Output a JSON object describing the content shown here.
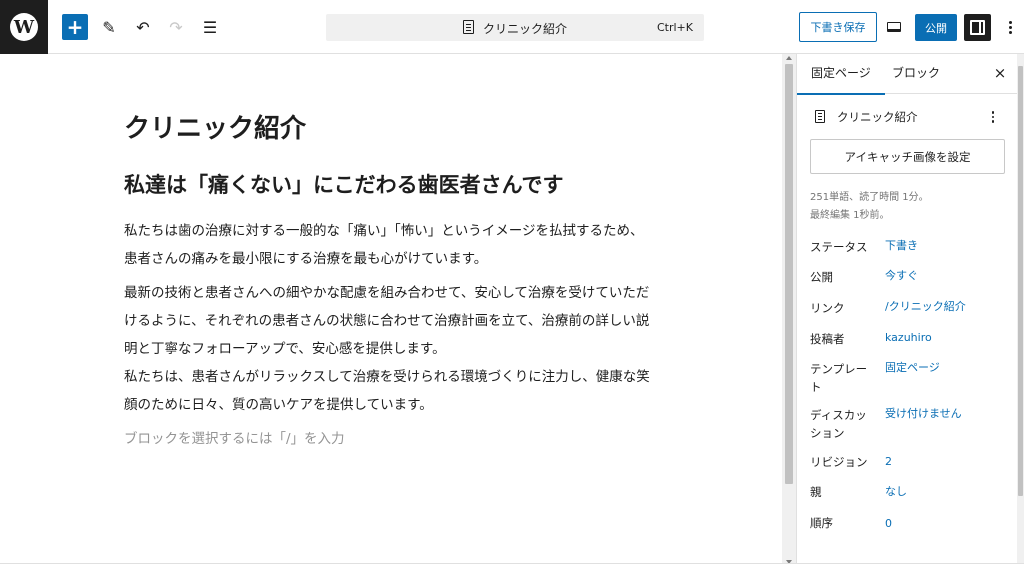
{
  "toolbar": {
    "logo_letter": "W",
    "add_symbol": "+",
    "tools_glyph": "✎",
    "undo_glyph": "↶",
    "redo_glyph": "↷",
    "list_glyph": "☰",
    "doc_title": "クリニック紹介",
    "shortcut": "Ctrl+K",
    "save_draft_label": "下書き保存",
    "publish_label": "公開"
  },
  "post": {
    "title": "クリニック紹介",
    "heading": "私達は「痛くない」にこだわる歯医者さんです",
    "paragraphs": [
      "私たちは歯の治療に対する一般的な「痛い」「怖い」というイメージを払拭するため、患者さんの痛みを最小限にする治療を最も心がけています。",
      "最新の技術と患者さんへの細やかな配慮を組み合わせて、安心して治療を受けていただけるように、それぞれの患者さんの状態に合わせて治療計画を立て、治療前の詳しい説明と丁寧なフォローアップで、安心感を提供します。",
      "私たちは、患者さんがリラックスして治療を受けられる環境づくりに注力し、健康な笑顔のために日々、質の高いケアを提供しています。"
    ],
    "placeholder": "ブロックを選択するには「/」を入力"
  },
  "sidebar": {
    "tab_page": "固定ページ",
    "tab_block": "ブロック",
    "close_glyph": "×",
    "doc_title": "クリニック紹介",
    "featured_image_label": "アイキャッチ画像を設定",
    "word_count": "251単語、読了時間 1分。",
    "last_edited": "最終編集 1秒前。",
    "rows": [
      {
        "label": "ステータス",
        "value": "下書き"
      },
      {
        "label": "公開",
        "value": "今すぐ"
      },
      {
        "label": "リンク",
        "value": "/クリニック紹介"
      },
      {
        "label": "投稿者",
        "value": "kazuhiro"
      },
      {
        "label": "テンプレート",
        "value": "固定ページ"
      },
      {
        "label": "ディスカッション",
        "value": "受け付けません"
      },
      {
        "label": "リビジョン",
        "value": "2"
      },
      {
        "label": "親",
        "value": "なし"
      },
      {
        "label": "順序",
        "value": "0"
      }
    ]
  },
  "colors": {
    "accent": "#0a6eb4",
    "dark": "#1e1e1e",
    "placeholder": "#949494"
  }
}
